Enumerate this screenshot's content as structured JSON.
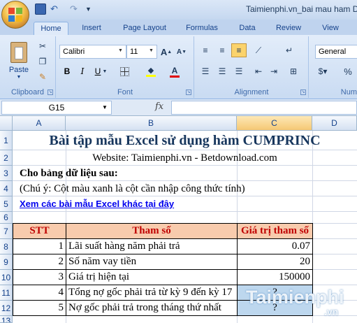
{
  "window": {
    "title": "Taimienphi.vn_bai mau ham D"
  },
  "tabs": [
    "Home",
    "Insert",
    "Page Layout",
    "Formulas",
    "Data",
    "Review",
    "View"
  ],
  "ribbon": {
    "clipboard": {
      "label": "Clipboard",
      "paste_label": "Paste"
    },
    "font": {
      "label": "Font",
      "font_name": "Calibri",
      "font_size": "11"
    },
    "alignment": {
      "label": "Alignment"
    },
    "number": {
      "label": "Num",
      "format": "General",
      "percent": "%"
    }
  },
  "formula_bar": {
    "cell_ref": "G15",
    "fx": "fx",
    "content": ""
  },
  "columns": [
    "A",
    "B",
    "C",
    "D"
  ],
  "rows": [
    "1",
    "2",
    "3",
    "4",
    "5",
    "6",
    "7",
    "8",
    "9",
    "10",
    "11",
    "12",
    "13"
  ],
  "sheet": {
    "title": "Bài tập mẫu Excel sử dụng hàm CUMPRINC",
    "website": "Website: Taimienphi.vn - Betdownload.com",
    "data_intro": "Cho bảng dữ liệu sau:",
    "note": "(Chú ý: Cột màu xanh là cột cần nhập công thức tính)",
    "link": "Xem các bài mẫu Excel khác tại đây",
    "headers": {
      "stt": "STT",
      "param": "Tham số",
      "value": "Giá trị tham số"
    },
    "table": [
      {
        "stt": "1",
        "param": "Lãi suất hàng năm phải trả",
        "value": "0.07"
      },
      {
        "stt": "2",
        "param": "Số năm vay tiền",
        "value": "20"
      },
      {
        "stt": "3",
        "param": "Giá trị hiện tại",
        "value": "150000"
      },
      {
        "stt": "4",
        "param": "Tổng nợ gốc phải trả từ kỳ 9 đến kỳ 17",
        "value": "?"
      },
      {
        "stt": "5",
        "param": "Nợ gốc phải trả trong tháng thứ nhất",
        "value": "?"
      }
    ]
  },
  "watermark": {
    "brand": "Taimienphi",
    "suffix": ".vn"
  },
  "colors": {
    "title_blue": "#17365d",
    "header_text": "#c00000",
    "header_fill": "#f8cbad",
    "input_fill": "#bdd7ee",
    "link": "#0000ee"
  }
}
